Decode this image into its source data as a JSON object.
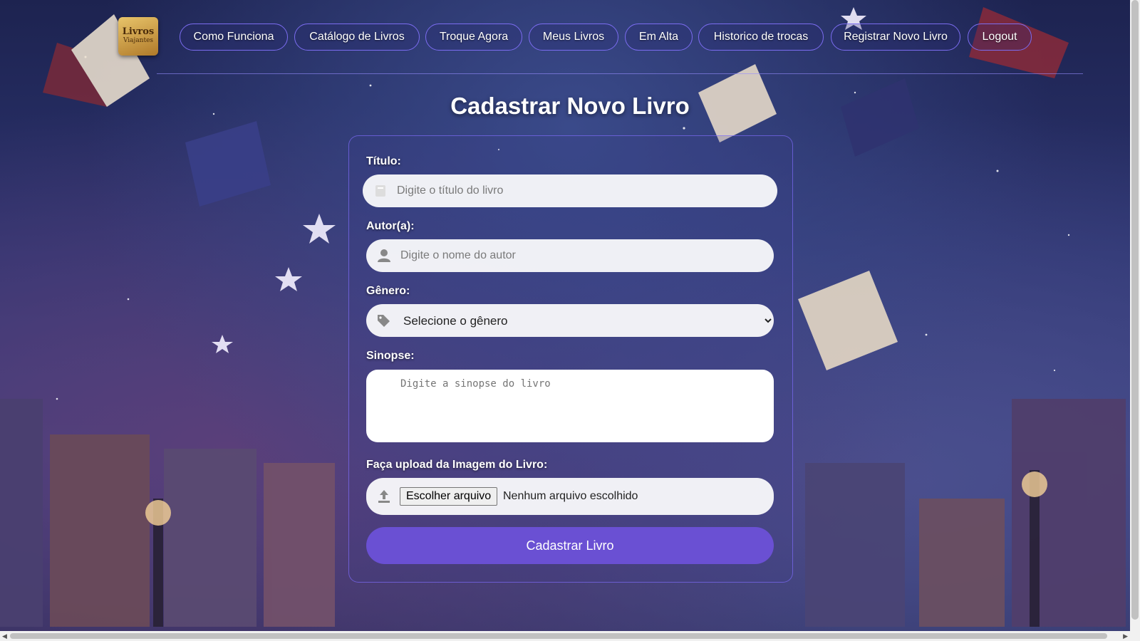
{
  "logo": {
    "line1": "Livros",
    "line2": "Viajantes"
  },
  "nav": {
    "items": [
      {
        "label": "Como Funciona"
      },
      {
        "label": "Catálogo de Livros"
      },
      {
        "label": "Troque Agora"
      },
      {
        "label": "Meus Livros"
      },
      {
        "label": "Em Alta"
      },
      {
        "label": "Historico de trocas"
      },
      {
        "label": "Registrar Novo Livro"
      },
      {
        "label": "Logout"
      }
    ]
  },
  "form": {
    "title": "Cadastrar Novo Livro",
    "titulo_label": "Título:",
    "titulo_placeholder": "Digite o título do livro",
    "autor_label": "Autor(a):",
    "autor_placeholder": "Digite o nome do autor",
    "genero_label": "Gênero:",
    "genero_selected": "Selecione o gênero",
    "sinopse_label": "Sinopse:",
    "sinopse_placeholder": "Digite a sinopse do livro",
    "upload_label": "Faça upload da Imagem do Livro:",
    "file_button": "Escolher arquivo",
    "file_status": "Nenhum arquivo escolhido",
    "submit_label": "Cadastrar Livro"
  },
  "colors": {
    "accent": "#6a50d3",
    "nav_border": "#7b6cf0",
    "background": "#2c3470"
  },
  "icons": {
    "titulo": "book-icon",
    "autor": "user-icon",
    "genero": "tags-icon",
    "upload": "upload-icon"
  }
}
